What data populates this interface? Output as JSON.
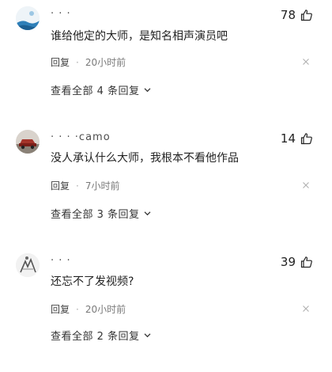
{
  "comments": [
    {
      "username": "· · ·",
      "likes": "78",
      "text": "谁给他定的大师，是知名相声演员吧",
      "reply_label": "回复",
      "time": "20小时前",
      "view_all": "查看全部 4 条回复",
      "avatar_icon": "avatar-blue-landscape"
    },
    {
      "username": "· · · ·camo",
      "likes": "14",
      "text": "没人承认什么大师，我根本不看他作品",
      "reply_label": "回复",
      "time": "7小时前",
      "view_all": "查看全部 3 条回复",
      "avatar_icon": "avatar-red-car"
    },
    {
      "username": "· · ·",
      "likes": "39",
      "text": "还忘不了发视频?",
      "reply_label": "回复",
      "time": "20小时前",
      "view_all": "查看全部 2 条回复",
      "avatar_icon": "avatar-grey-sketch"
    }
  ],
  "separator": "·",
  "icons": {
    "like": "thumbs-up-icon",
    "close": "close-icon",
    "expand": "chevron-down-icon"
  },
  "colors": {
    "text": "#222222",
    "meta": "#7a7a7a",
    "icon": "#222222"
  }
}
